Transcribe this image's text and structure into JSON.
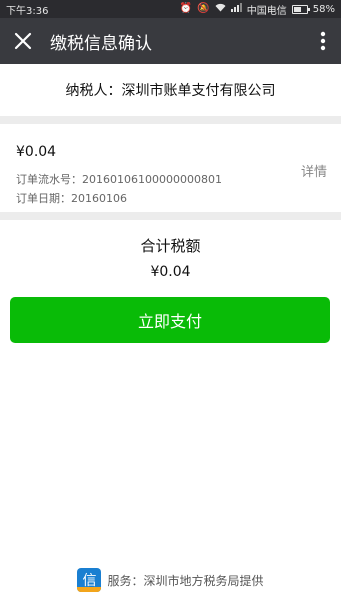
{
  "status_bar": {
    "time": "下午3:36",
    "carrier": "中国电信",
    "battery": "58%",
    "battery_level": 0.58
  },
  "nav": {
    "title": "缴税信息确认"
  },
  "taxpayer": {
    "text": "纳税人：深圳市账单支付有限公司"
  },
  "order": {
    "amount": "¥0.04",
    "serial": "订单流水号：20160106100000000801",
    "date": "订单日期：20160106",
    "detail_label": "详情"
  },
  "summary": {
    "label": "合计税额",
    "amount": "¥0.04"
  },
  "pay_button": {
    "label": "立即支付"
  },
  "footer": {
    "logo_char": "信",
    "text": "服务：深圳市地方税务局提供"
  },
  "colors": {
    "nav_bg": "#393a3f",
    "status_bg": "#2b2b2f",
    "button_green": "#09bb07"
  }
}
